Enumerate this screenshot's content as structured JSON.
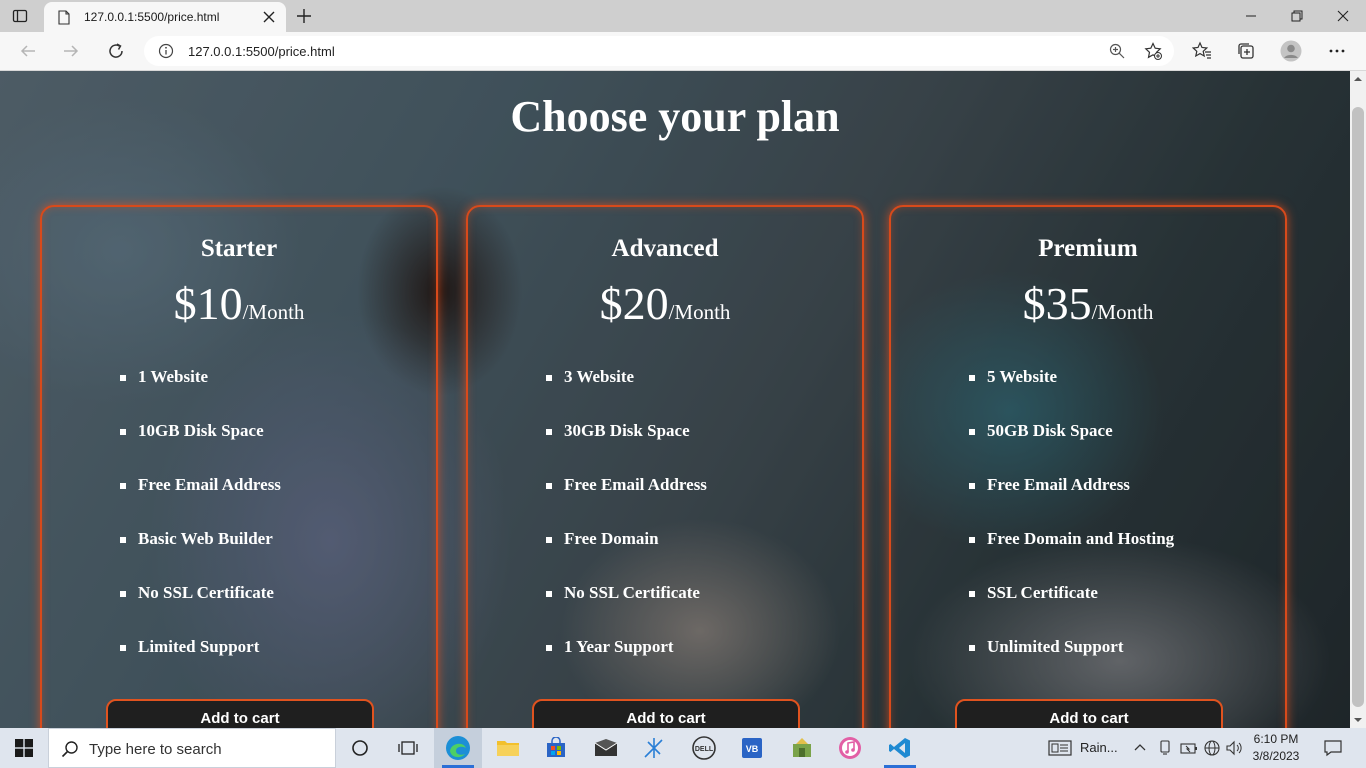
{
  "browser": {
    "tab_title": "127.0.0.1:5500/price.html",
    "url": "127.0.0.1:5500/price.html"
  },
  "page": {
    "title": "Choose your plan",
    "accent_color": "#e0531f",
    "plans": [
      {
        "name": "Starter",
        "price": "$10",
        "period": "/Month",
        "features": [
          "1 Website",
          "10GB Disk Space",
          "Free Email Address",
          "Basic Web Builder",
          "No SSL Certificate",
          "Limited Support"
        ],
        "button_label": "Add to cart"
      },
      {
        "name": "Advanced",
        "price": "$20",
        "period": "/Month",
        "features": [
          "3 Website",
          "30GB Disk Space",
          "Free Email Address",
          "Free Domain",
          "No SSL Certificate",
          "1 Year Support"
        ],
        "button_label": "Add to cart"
      },
      {
        "name": "Premium",
        "price": "$35",
        "period": "/Month",
        "features": [
          "5 Website",
          "50GB Disk Space",
          "Free Email Address",
          "Free Domain and Hosting",
          "SSL Certificate",
          "Unlimited Support"
        ],
        "button_label": "Add to cart"
      }
    ]
  },
  "taskbar": {
    "search_placeholder": "Type here to search",
    "weather": "Rain...",
    "time": "6:10 PM",
    "date": "3/8/2023"
  }
}
